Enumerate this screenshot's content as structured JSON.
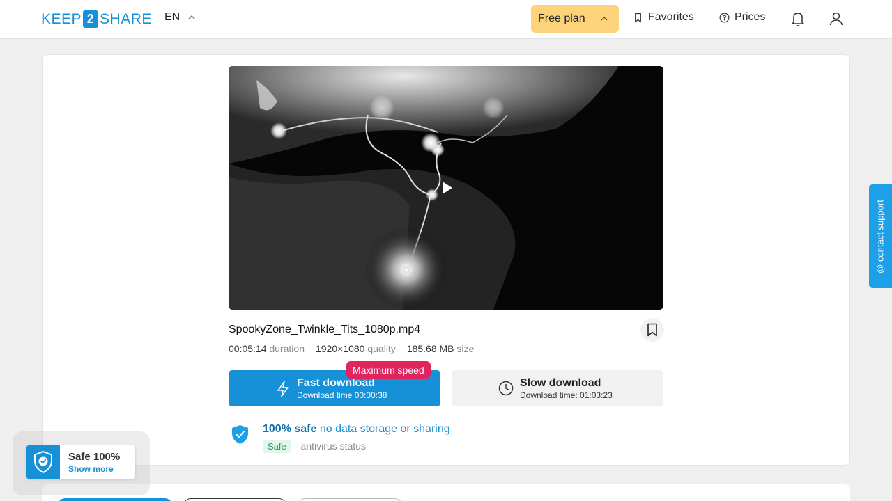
{
  "header": {
    "logo_left": "KEEP",
    "logo_mid": "2",
    "logo_right": "SHARE",
    "language": "EN",
    "free_plan": "Free plan",
    "favorites": "Favorites",
    "prices": "Prices"
  },
  "file": {
    "title": "SpookyZone_Twinkle_Tits_1080p.mp4",
    "duration_value": "00:05:14",
    "duration_label": "duration",
    "quality_value": "1920×1080",
    "quality_label": "quality",
    "size_value": "185.68 MB",
    "size_label": "size"
  },
  "download": {
    "badge": "Maximum speed",
    "fast_title": "Fast download",
    "fast_sub": "Download time 00:00:38",
    "slow_title": "Slow download",
    "slow_sub": "Download time: 01:03:23"
  },
  "safety": {
    "bold": "100% safe",
    "rest": " no data storage or sharing",
    "badge": "Safe",
    "status": "- antivirus status"
  },
  "floating": {
    "title": "Safe 100%",
    "link": "Show more"
  },
  "contact": "@ contact support",
  "icons": {
    "lang_toggle": "chevron-up-icon",
    "favorites": "bookmark-icon",
    "prices": "help-circle-icon",
    "notifications": "bell-icon",
    "account": "user-icon",
    "fast": "lightning-icon",
    "slow": "clock-icon",
    "safety": "shield-check-icon"
  },
  "colors": {
    "brand": "#1690d6",
    "free_plan": "#fcd27a",
    "badge": "#e0245e",
    "contact": "#1da0e8"
  }
}
